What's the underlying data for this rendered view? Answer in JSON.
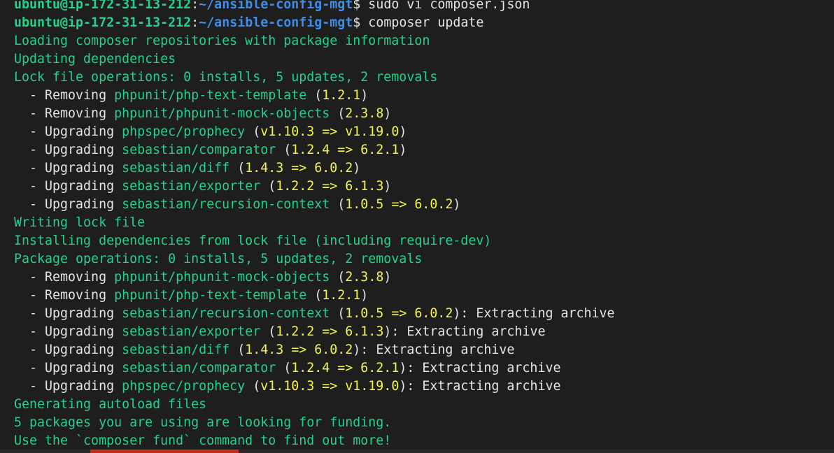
{
  "colors": {
    "background": "#1e1e1e",
    "default": "#e5e5e5",
    "prompt_user": "#23d18b",
    "prompt_path": "#3b8eea",
    "info_green": "#23d18b",
    "package_green": "#23d18b",
    "version_yellow": "#f5f543",
    "accent_red": "#c42b1c"
  },
  "terminal": {
    "lines": [
      [
        {
          "t": "ubuntu@ip-172-31-13-212",
          "c": "prompt_user",
          "b": true
        },
        {
          "t": ":",
          "c": "default"
        },
        {
          "t": "~/ansible-config-mgt",
          "c": "prompt_path",
          "b": true
        },
        {
          "t": "$ sudo vi composer.json",
          "c": "default"
        }
      ],
      [
        {
          "t": "ubuntu@ip-172-31-13-212",
          "c": "prompt_user",
          "b": true
        },
        {
          "t": ":",
          "c": "default"
        },
        {
          "t": "~/ansible-config-mgt",
          "c": "prompt_path",
          "b": true
        },
        {
          "t": "$ composer update",
          "c": "default"
        }
      ],
      [
        {
          "t": "Loading composer repositories with package information",
          "c": "info_green"
        }
      ],
      [
        {
          "t": "Updating dependencies",
          "c": "info_green"
        }
      ],
      [
        {
          "t": "Lock file operations: 0 installs, 5 updates, 2 removals",
          "c": "info_green"
        }
      ],
      [
        {
          "t": "  - Removing ",
          "c": "default"
        },
        {
          "t": "phpunit/php-text-template",
          "c": "package_green"
        },
        {
          "t": " (",
          "c": "default"
        },
        {
          "t": "1.2.1",
          "c": "version_yellow"
        },
        {
          "t": ")",
          "c": "default"
        }
      ],
      [
        {
          "t": "  - Removing ",
          "c": "default"
        },
        {
          "t": "phpunit/phpunit-mock-objects",
          "c": "package_green"
        },
        {
          "t": " (",
          "c": "default"
        },
        {
          "t": "2.3.8",
          "c": "version_yellow"
        },
        {
          "t": ")",
          "c": "default"
        }
      ],
      [
        {
          "t": "  - Upgrading ",
          "c": "default"
        },
        {
          "t": "phpspec/prophecy",
          "c": "package_green"
        },
        {
          "t": " (",
          "c": "default"
        },
        {
          "t": "v1.10.3 => v1.19.0",
          "c": "version_yellow"
        },
        {
          "t": ")",
          "c": "default"
        }
      ],
      [
        {
          "t": "  - Upgrading ",
          "c": "default"
        },
        {
          "t": "sebastian/comparator",
          "c": "package_green"
        },
        {
          "t": " (",
          "c": "default"
        },
        {
          "t": "1.2.4 => 6.2.1",
          "c": "version_yellow"
        },
        {
          "t": ")",
          "c": "default"
        }
      ],
      [
        {
          "t": "  - Upgrading ",
          "c": "default"
        },
        {
          "t": "sebastian/diff",
          "c": "package_green"
        },
        {
          "t": " (",
          "c": "default"
        },
        {
          "t": "1.4.3 => 6.0.2",
          "c": "version_yellow"
        },
        {
          "t": ")",
          "c": "default"
        }
      ],
      [
        {
          "t": "  - Upgrading ",
          "c": "default"
        },
        {
          "t": "sebastian/exporter",
          "c": "package_green"
        },
        {
          "t": " (",
          "c": "default"
        },
        {
          "t": "1.2.2 => 6.1.3",
          "c": "version_yellow"
        },
        {
          "t": ")",
          "c": "default"
        }
      ],
      [
        {
          "t": "  - Upgrading ",
          "c": "default"
        },
        {
          "t": "sebastian/recursion-context",
          "c": "package_green"
        },
        {
          "t": " (",
          "c": "default"
        },
        {
          "t": "1.0.5 => 6.0.2",
          "c": "version_yellow"
        },
        {
          "t": ")",
          "c": "default"
        }
      ],
      [
        {
          "t": "Writing lock file",
          "c": "info_green"
        }
      ],
      [
        {
          "t": "Installing dependencies from lock file (including require-dev)",
          "c": "info_green"
        }
      ],
      [
        {
          "t": "Package operations: 0 installs, 5 updates, 2 removals",
          "c": "info_green"
        }
      ],
      [
        {
          "t": "  - Removing ",
          "c": "default"
        },
        {
          "t": "phpunit/phpunit-mock-objects",
          "c": "package_green"
        },
        {
          "t": " (",
          "c": "default"
        },
        {
          "t": "2.3.8",
          "c": "version_yellow"
        },
        {
          "t": ")",
          "c": "default"
        }
      ],
      [
        {
          "t": "  - Removing ",
          "c": "default"
        },
        {
          "t": "phpunit/php-text-template",
          "c": "package_green"
        },
        {
          "t": " (",
          "c": "default"
        },
        {
          "t": "1.2.1",
          "c": "version_yellow"
        },
        {
          "t": ")",
          "c": "default"
        }
      ],
      [
        {
          "t": "  - Upgrading ",
          "c": "default"
        },
        {
          "t": "sebastian/recursion-context",
          "c": "package_green"
        },
        {
          "t": " (",
          "c": "default"
        },
        {
          "t": "1.0.5 => 6.0.2",
          "c": "version_yellow"
        },
        {
          "t": "): Extracting archive",
          "c": "default"
        }
      ],
      [
        {
          "t": "  - Upgrading ",
          "c": "default"
        },
        {
          "t": "sebastian/exporter",
          "c": "package_green"
        },
        {
          "t": " (",
          "c": "default"
        },
        {
          "t": "1.2.2 => 6.1.3",
          "c": "version_yellow"
        },
        {
          "t": "): Extracting archive",
          "c": "default"
        }
      ],
      [
        {
          "t": "  - Upgrading ",
          "c": "default"
        },
        {
          "t": "sebastian/diff",
          "c": "package_green"
        },
        {
          "t": " (",
          "c": "default"
        },
        {
          "t": "1.4.3 => 6.0.2",
          "c": "version_yellow"
        },
        {
          "t": "): Extracting archive",
          "c": "default"
        }
      ],
      [
        {
          "t": "  - Upgrading ",
          "c": "default"
        },
        {
          "t": "sebastian/comparator",
          "c": "package_green"
        },
        {
          "t": " (",
          "c": "default"
        },
        {
          "t": "1.2.4 => 6.2.1",
          "c": "version_yellow"
        },
        {
          "t": "): Extracting archive",
          "c": "default"
        }
      ],
      [
        {
          "t": "  - Upgrading ",
          "c": "default"
        },
        {
          "t": "phpspec/prophecy",
          "c": "package_green"
        },
        {
          "t": " (",
          "c": "default"
        },
        {
          "t": "v1.10.3 => v1.19.0",
          "c": "version_yellow"
        },
        {
          "t": "): Extracting archive",
          "c": "default"
        }
      ],
      [
        {
          "t": "Generating autoload files",
          "c": "info_green"
        }
      ],
      [
        {
          "t": "5 packages you are using are looking for funding.",
          "c": "info_green"
        }
      ],
      [
        {
          "t": "Use the `composer fund` command to find out more!",
          "c": "info_green"
        }
      ]
    ]
  }
}
